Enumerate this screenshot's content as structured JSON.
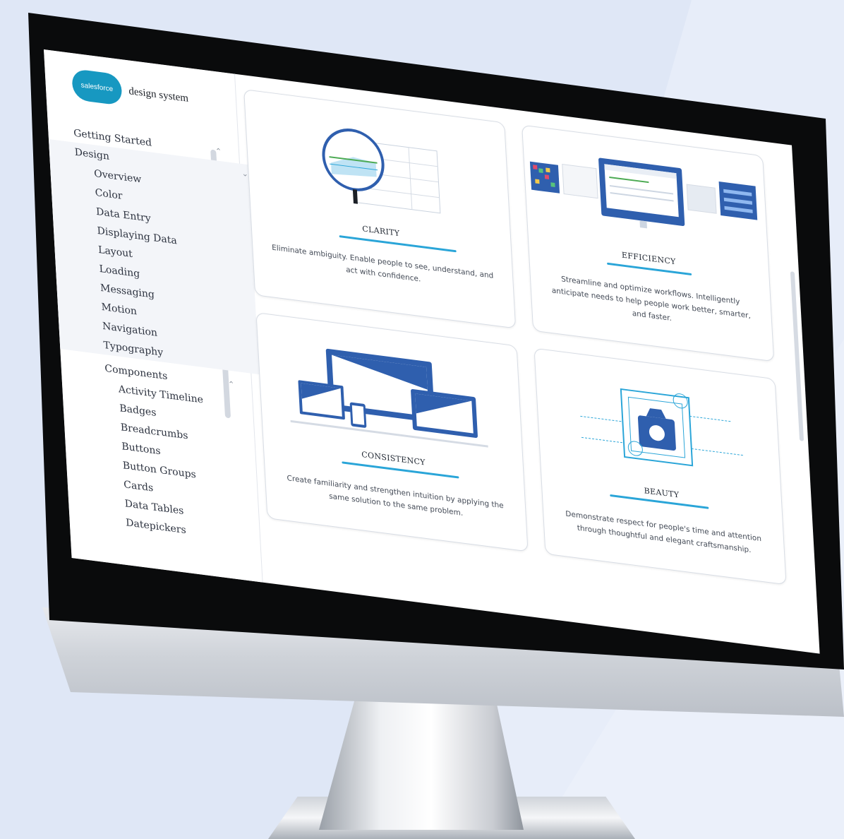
{
  "brand": {
    "logo_text": "salesforce",
    "name": "design system"
  },
  "sidebar": {
    "top_items": [
      {
        "label": "Getting Started"
      },
      {
        "label": "Design"
      }
    ],
    "design_items": [
      {
        "label": "Overview"
      },
      {
        "label": "Color"
      },
      {
        "label": "Data Entry"
      },
      {
        "label": "Displaying Data"
      },
      {
        "label": "Layout"
      },
      {
        "label": "Loading"
      },
      {
        "label": "Messaging"
      },
      {
        "label": "Motion"
      },
      {
        "label": "Navigation"
      },
      {
        "label": "Typography"
      }
    ],
    "components_label": "Components",
    "component_items": [
      {
        "label": "Activity Timeline"
      },
      {
        "label": "Badges"
      },
      {
        "label": "Breadcrumbs"
      },
      {
        "label": "Buttons"
      },
      {
        "label": "Button Groups"
      },
      {
        "label": "Cards"
      },
      {
        "label": "Data Tables"
      },
      {
        "label": "Datepickers"
      }
    ]
  },
  "cards": {
    "clarity": {
      "title": "CLARITY",
      "description": "Eliminate ambiguity. Enable people to see, understand, and act with confidence."
    },
    "efficiency": {
      "title": "EFFICIENCY",
      "description": "Streamline and optimize workflows. Intelligently anticipate needs to help people work better, smarter, and faster."
    },
    "consistency": {
      "title": "CONSISTENCY",
      "description": "Create familiarity and strengthen intuition by applying the same solution to the same problem."
    },
    "beauty": {
      "title": "BEAUTY",
      "description": "Demonstrate respect for people's time and attention through thoughtful and elegant craftsmanship."
    }
  },
  "colors": {
    "accent": "#2aa5d8",
    "illustration_blue": "#2f5fae",
    "brand_blue": "#1798c1"
  }
}
